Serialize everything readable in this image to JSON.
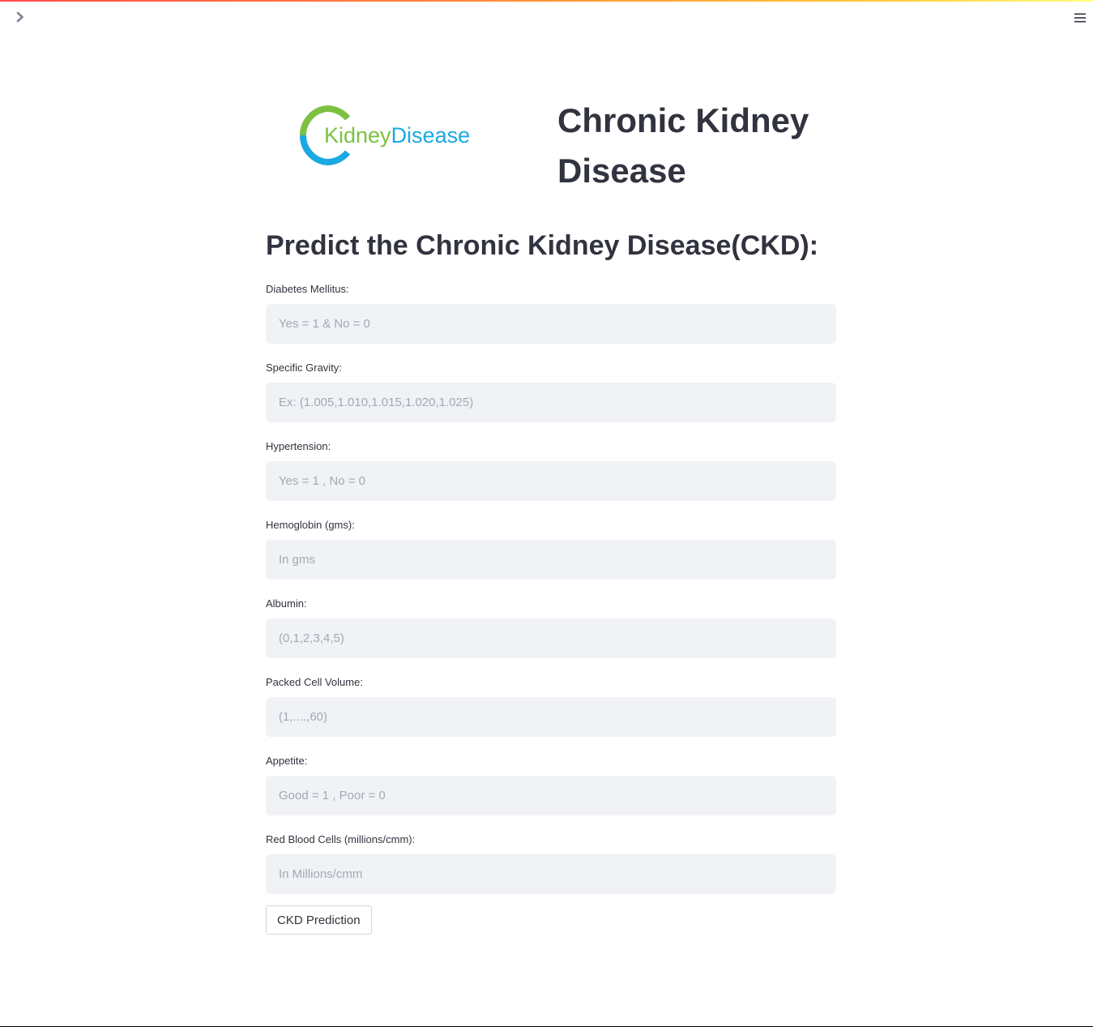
{
  "header": {
    "accent_gradient": [
      "#ff4b4b",
      "#ffc93c",
      "#fffd80"
    ],
    "sidebar_toggle_icon": "chevron-right-icon",
    "menu_icon": "hamburger-menu-icon"
  },
  "logo": {
    "part1": "Kidney",
    "part2": "Disease",
    "colors": {
      "green": "#7cc142",
      "blue": "#1aa9e1"
    }
  },
  "title": "Chronic Kidney Disease",
  "subtitle": "Predict the Chronic Kidney Disease(CKD):",
  "fields": [
    {
      "label": "Diabetes Mellitus:",
      "placeholder": "Yes = 1 & No = 0",
      "value": ""
    },
    {
      "label": "Specific Gravity:",
      "placeholder": "Ex: (1.005,1.010,1.015,1.020,1.025)",
      "value": ""
    },
    {
      "label": "Hypertension:",
      "placeholder": "Yes = 1 , No = 0",
      "value": ""
    },
    {
      "label": "Hemoglobin (gms):",
      "placeholder": "In gms",
      "value": ""
    },
    {
      "label": "Albumin:",
      "placeholder": "(0,1,2,3,4,5)",
      "value": ""
    },
    {
      "label": "Packed Cell Volume:",
      "placeholder": "(1,....,60)",
      "value": ""
    },
    {
      "label": "Appetite:",
      "placeholder": "Good = 1 , Poor = 0",
      "value": ""
    },
    {
      "label": "Red Blood Cells (millions/cmm):",
      "placeholder": "In Millions/cmm",
      "value": ""
    }
  ],
  "submit_label": "CKD Prediction"
}
